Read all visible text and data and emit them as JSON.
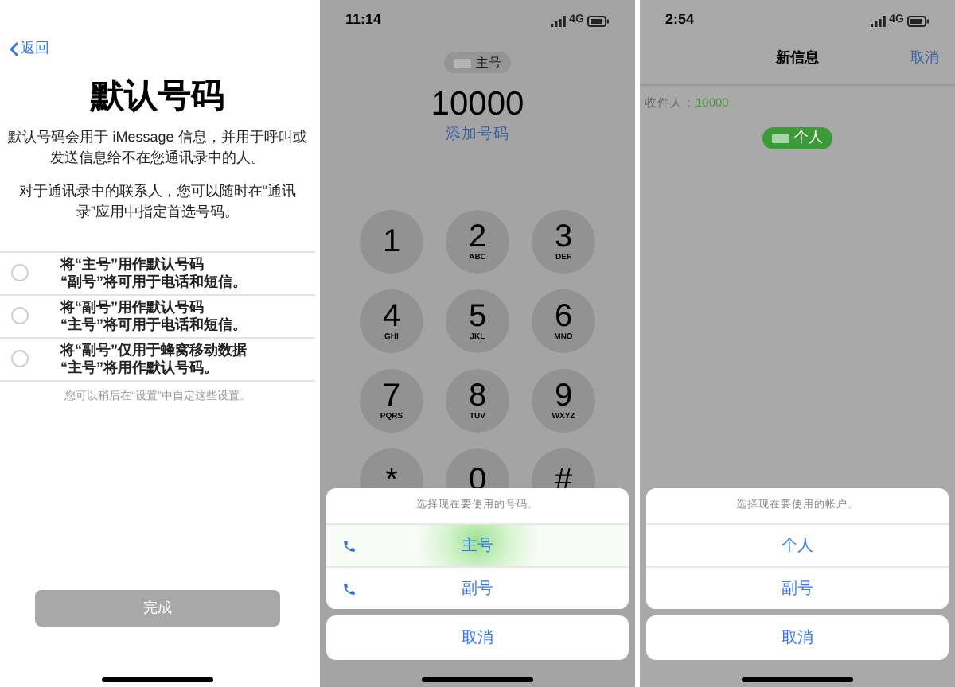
{
  "setup_screen": {
    "back": "返回",
    "title": "默认号码",
    "paragraphs": [
      "默认号码会用于 iMessage 信息，并用于呼叫或发送信息给不在您通讯录中的人。",
      "对于通讯录中的联系人，您可以随时在“通讯录”应用中指定首选号码。"
    ],
    "options": [
      {
        "line1": "将“主号”用作默认号码",
        "line2": "“副号”将可用于电话和短信。",
        "selected": false
      },
      {
        "line1": "将“副号”用作默认号码",
        "line2": "“主号”将可用于电话和短信。",
        "selected": false
      },
      {
        "line1": "将“副号”仅用于蜂窝移动数据",
        "line2": "“主号”将用作默认号码。",
        "selected": false
      }
    ],
    "footnote": "您可以稍后在“设置”中自定这些设置。",
    "done_button": {
      "label": "完成",
      "disabled": true
    }
  },
  "dialer_screen": {
    "time": "11:14",
    "network": "4G",
    "line_label": "主号",
    "number": "10000",
    "add_number": "添加号码",
    "keys": [
      {
        "digit": "1"
      },
      {
        "digit": "2",
        "letters": "ABC"
      },
      {
        "digit": "3",
        "letters": "DEF"
      },
      {
        "digit": "4",
        "letters": "GHI"
      },
      {
        "digit": "5",
        "letters": "JKL"
      },
      {
        "digit": "6",
        "letters": "MNO"
      },
      {
        "digit": "7",
        "letters": "PQRS"
      },
      {
        "digit": "8",
        "letters": "TUV"
      },
      {
        "digit": "9",
        "letters": "WXYZ"
      },
      {
        "digit": "*"
      },
      {
        "digit": "0"
      },
      {
        "digit": "#"
      }
    ],
    "sheet": {
      "title": "选择现在要使用的号码。",
      "items": [
        {
          "label": "主号",
          "kind": "call",
          "pressed": true
        },
        {
          "label": "副号",
          "kind": "call",
          "pressed": false
        }
      ],
      "cancel": "取消"
    }
  },
  "message_screen": {
    "time": "2:54",
    "network": "4G",
    "title": "新信息",
    "cancel": "取消",
    "to_label": "收件人：",
    "to_value": "10000",
    "line_label": "个人",
    "sheet": {
      "title": "选择现在要使用的帐户。",
      "items": [
        {
          "label": "个人",
          "kind": "plain",
          "pressed": false
        },
        {
          "label": "副号",
          "kind": "plain",
          "pressed": false
        }
      ],
      "cancel": "取消"
    }
  }
}
